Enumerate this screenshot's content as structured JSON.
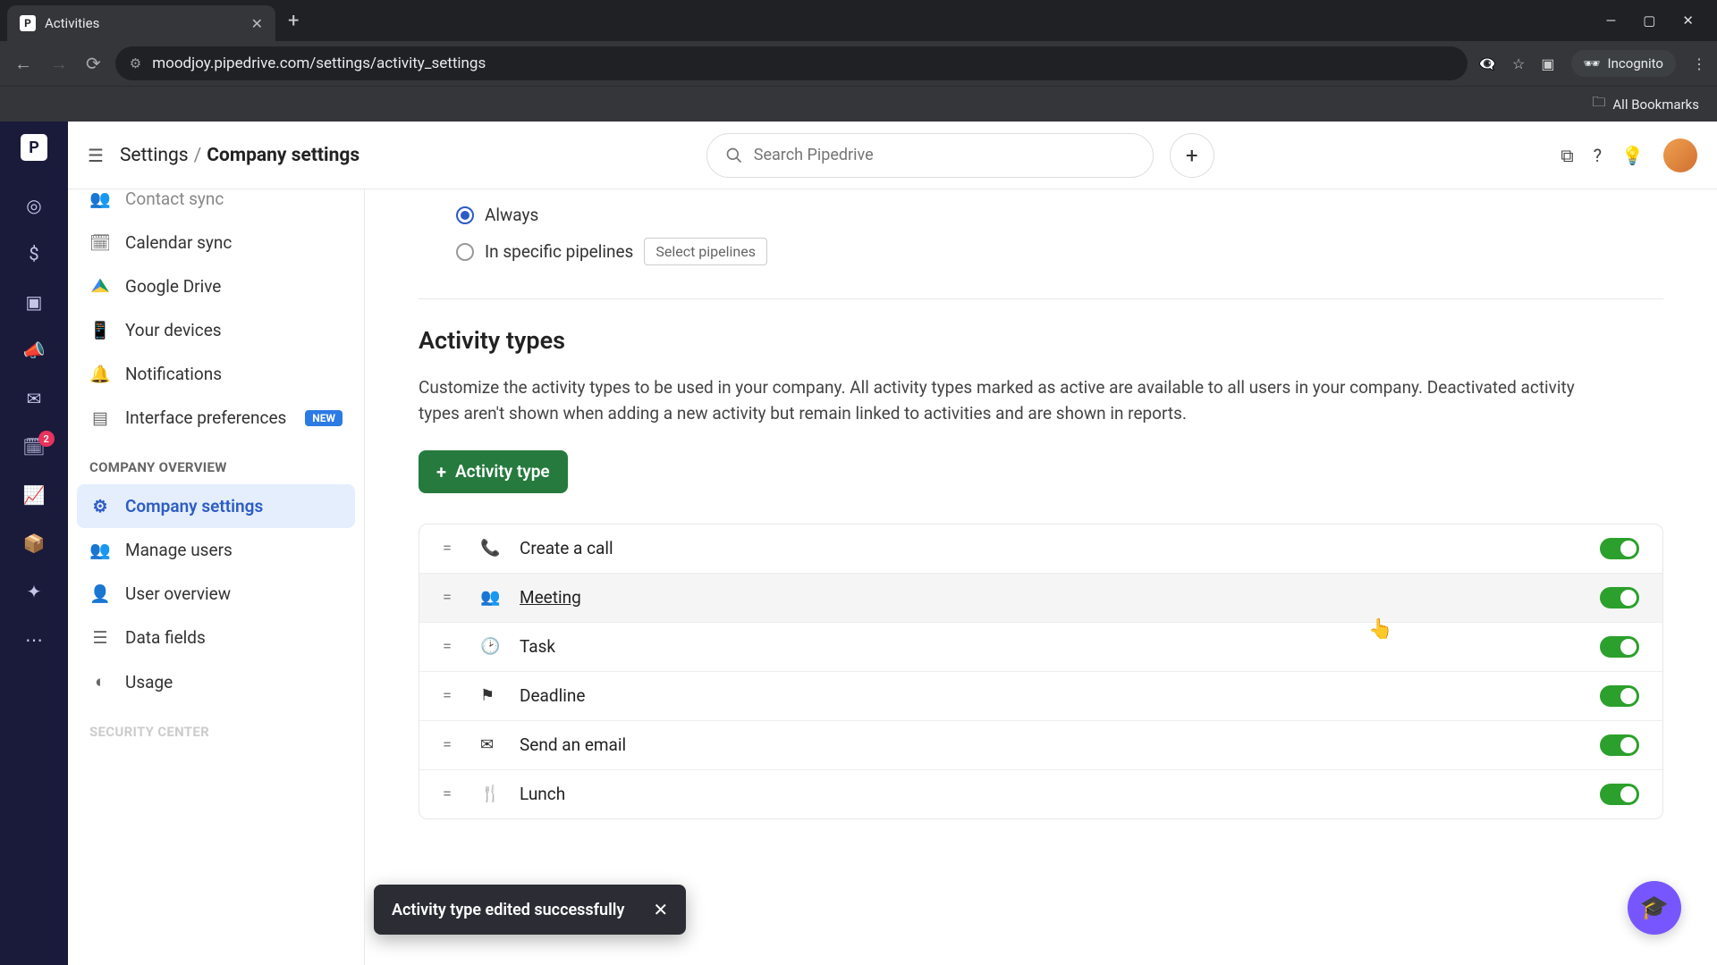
{
  "browser": {
    "tab_title": "Activities",
    "url": "moodjoy.pipedrive.com/settings/activity_settings",
    "incognito_label": "Incognito",
    "all_bookmarks": "All Bookmarks"
  },
  "topbar": {
    "breadcrumb_root": "Settings",
    "breadcrumb_current": "Company settings",
    "search_placeholder": "Search Pipedrive"
  },
  "rail_badge": "2",
  "sidebar": {
    "items_top": [
      {
        "label": "Contact sync",
        "icon": "contact"
      },
      {
        "label": "Calendar sync",
        "icon": "calendar"
      },
      {
        "label": "Google Drive",
        "icon": "gdrive"
      },
      {
        "label": "Your devices",
        "icon": "device"
      },
      {
        "label": "Notifications",
        "icon": "bell"
      },
      {
        "label": "Interface preferences",
        "icon": "layout",
        "badge": "NEW"
      }
    ],
    "heading": "COMPANY OVERVIEW",
    "items_company": [
      {
        "label": "Company settings",
        "icon": "gear",
        "active": true
      },
      {
        "label": "Manage users",
        "icon": "users"
      },
      {
        "label": "User overview",
        "icon": "user"
      },
      {
        "label": "Data fields",
        "icon": "fields"
      },
      {
        "label": "Usage",
        "icon": "gauge"
      }
    ],
    "security_heading": "SECURITY CENTER"
  },
  "main": {
    "radio_always": "Always",
    "radio_pipelines": "In specific pipelines",
    "select_pipelines_btn": "Select pipelines",
    "section_title": "Activity types",
    "section_desc": "Customize the activity types to be used in your company. All activity types marked as active are available to all users in your company. Deactivated activity types aren't shown when adding a new activity but remain linked to activities and are shown in reports.",
    "add_btn": "Activity type",
    "activities": [
      {
        "name": "Create a call",
        "icon": "phone",
        "on": true
      },
      {
        "name": "Meeting",
        "icon": "people",
        "on": true,
        "hover": true,
        "link": true
      },
      {
        "name": "Task",
        "icon": "clock",
        "on": true
      },
      {
        "name": "Deadline",
        "icon": "flag",
        "on": true
      },
      {
        "name": "Send an email",
        "icon": "mail",
        "on": true
      },
      {
        "name": "Lunch",
        "icon": "food",
        "on": true
      }
    ]
  },
  "toast": {
    "message": "Activity type edited successfully"
  }
}
